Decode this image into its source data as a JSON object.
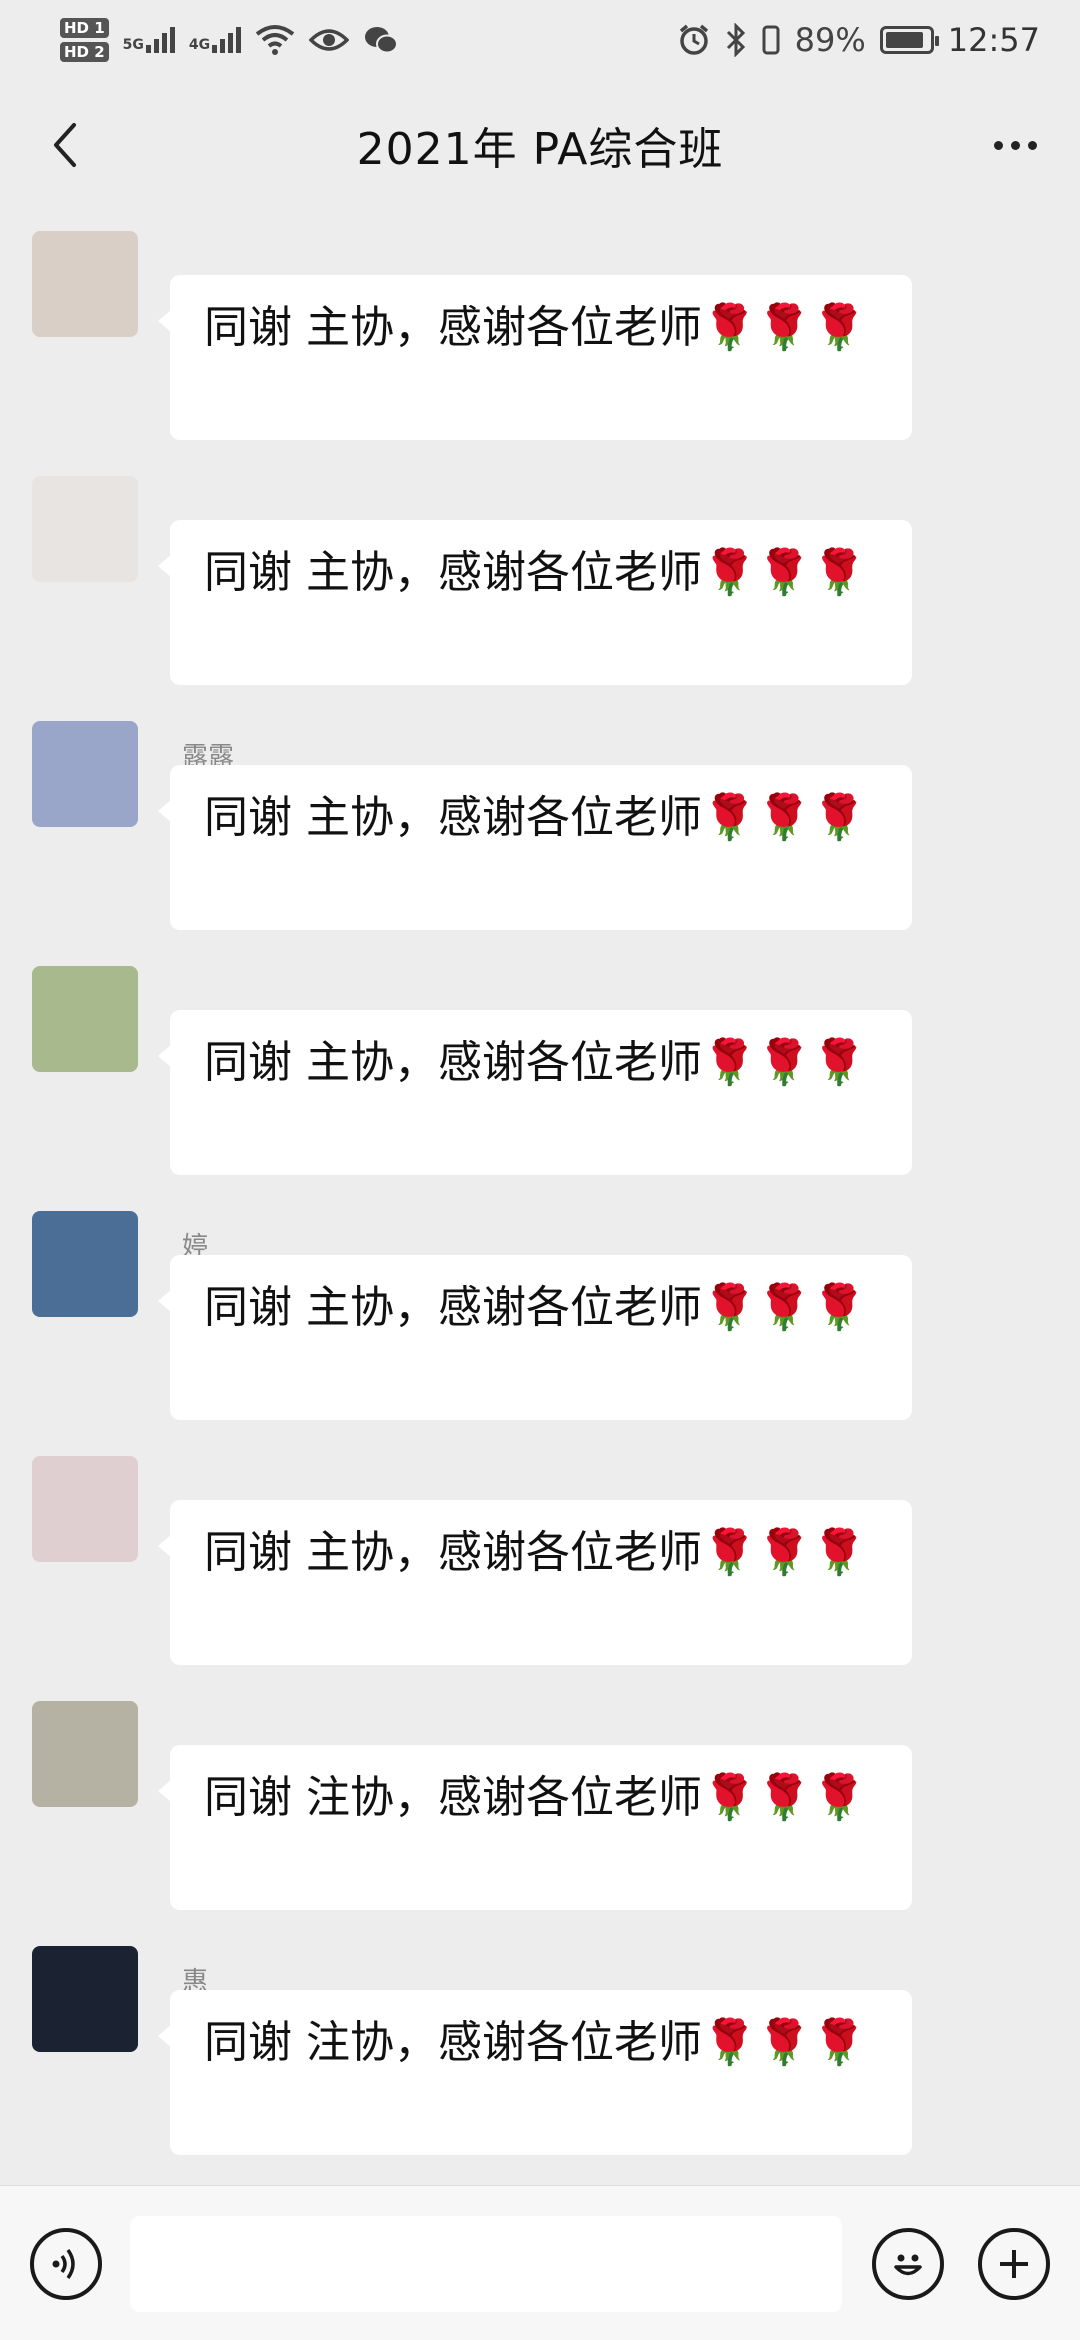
{
  "status_bar": {
    "hd1": "HD 1",
    "hd2": "HD 2",
    "net1": "5G",
    "net2": "4G",
    "battery_pct": "89%",
    "battery_level": 0.89,
    "time": "12:57"
  },
  "nav": {
    "title": "2021年     PA综合班"
  },
  "messages": [
    {
      "sender": "",
      "text": "同谢  主协，感谢各位老师🌹🌹🌹",
      "avatar_color": "#d9cfc7"
    },
    {
      "sender": "",
      "text": "同谢  主协，感谢各位老师🌹🌹🌹",
      "avatar_color": "#e8e4e2"
    },
    {
      "sender": "露露",
      "text": "同谢  主协，感谢各位老师🌹🌹🌹",
      "avatar_color": "#9aa6c9"
    },
    {
      "sender": "",
      "text": "同谢  主协，感谢各位老师🌹🌹🌹",
      "avatar_color": "#a8b98e"
    },
    {
      "sender": "婷",
      "text": "同谢  主协，感谢各位老师🌹🌹🌹",
      "avatar_color": "#4b6e97"
    },
    {
      "sender": "",
      "text": "同谢  主协，感谢各位老师🌹🌹🌹",
      "avatar_color": "#e0cfd0"
    },
    {
      "sender": "",
      "text": "同谢  注协，感谢各位老师🌹🌹🌹",
      "avatar_color": "#b6b2a3"
    },
    {
      "sender": "惠",
      "text": "同谢  注协，感谢各位老师🌹🌹🌹",
      "avatar_color": "#1b2231"
    }
  ],
  "input": {
    "placeholder": ""
  },
  "icons": {
    "back": "chevron-left-icon",
    "more": "more-dots-icon",
    "voice": "voice-icon",
    "emoji": "emoji-icon",
    "plus": "plus-icon"
  }
}
